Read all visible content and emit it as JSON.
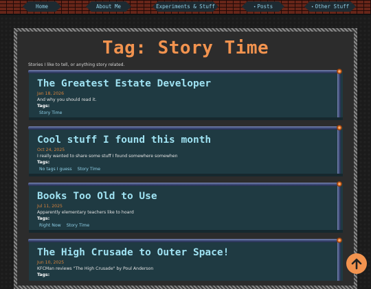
{
  "nav": {
    "items": [
      {
        "label": "Home",
        "dot": ""
      },
      {
        "label": "About Me",
        "dot": ""
      },
      {
        "label": "Experiments & Stuff",
        "dot": ""
      },
      {
        "label": "Posts",
        "dot": "•"
      },
      {
        "label": "Other Stuff",
        "dot": "•"
      }
    ]
  },
  "page": {
    "title": "Tag: Story Time",
    "subtitle": "Stories I like to tell, or anything story related."
  },
  "posts": [
    {
      "title": "The Greatest Estate Developer",
      "date": "Jan 18, 2026",
      "desc": "And why you should read it.",
      "tags_label": "Tags:",
      "tags": [
        "Story Time"
      ]
    },
    {
      "title": "Cool stuff I found this month",
      "date": "Oct 24, 2025",
      "desc": "I really wanted to share some stuff I found somewhere somewhen",
      "tags_label": "Tags:",
      "tags": [
        "No tags I guess",
        "Story Time"
      ]
    },
    {
      "title": "Books Too Old to Use",
      "date": "Jul 11, 2025",
      "desc": "Apparently elementary teachers like to hoard",
      "tags_label": "Tags:",
      "tags": [
        "Right Now",
        "Story Time"
      ]
    },
    {
      "title": "The High Crusade to Outer Space!",
      "date": "Jun 10, 2025",
      "desc": "KFCMan reviews \"The High Crusade\" by Poul Anderson",
      "tags_label": "Tags:",
      "tags": []
    }
  ],
  "colors": {
    "accent": "#f2934f",
    "card_bg": "#1f3a42",
    "card_title": "#9fe2f2",
    "date": "#d6823c",
    "tag_link": "#8fd0e8"
  },
  "icons": {
    "scroll_up": "arrow-up-icon"
  }
}
